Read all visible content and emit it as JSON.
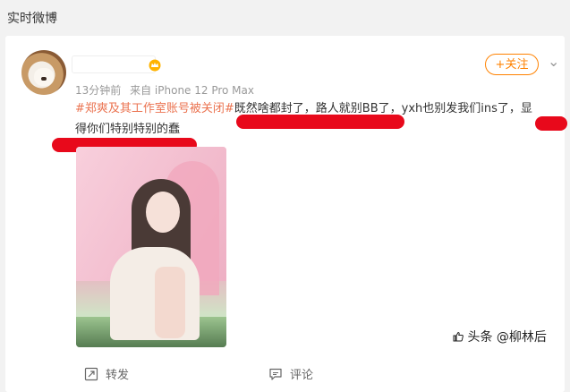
{
  "section": {
    "title": "实时微博"
  },
  "post": {
    "time": "13分钟前",
    "source": "来自 iPhone 12 Pro Max",
    "follow_label": "+关注",
    "hashtag": "#郑爽及其工作室账号被关闭#",
    "text_main": "既然啥都封了，路人就别BB了，yxh也别发我们ins了，显",
    "text_line2": "得你们特别特别的蠢"
  },
  "actions": {
    "forward": "转发",
    "comment": "评论"
  },
  "watermark": "头条 @柳林后",
  "icons": {
    "vip": "vip-crown-icon",
    "menu": "chevron-down-icon",
    "forward": "forward-icon",
    "comment": "comment-icon",
    "watermark": "thumb-up-icon"
  },
  "colors": {
    "follow": "#ff8200",
    "hashtag": "#eb7350",
    "redaction": "#e8091b"
  }
}
